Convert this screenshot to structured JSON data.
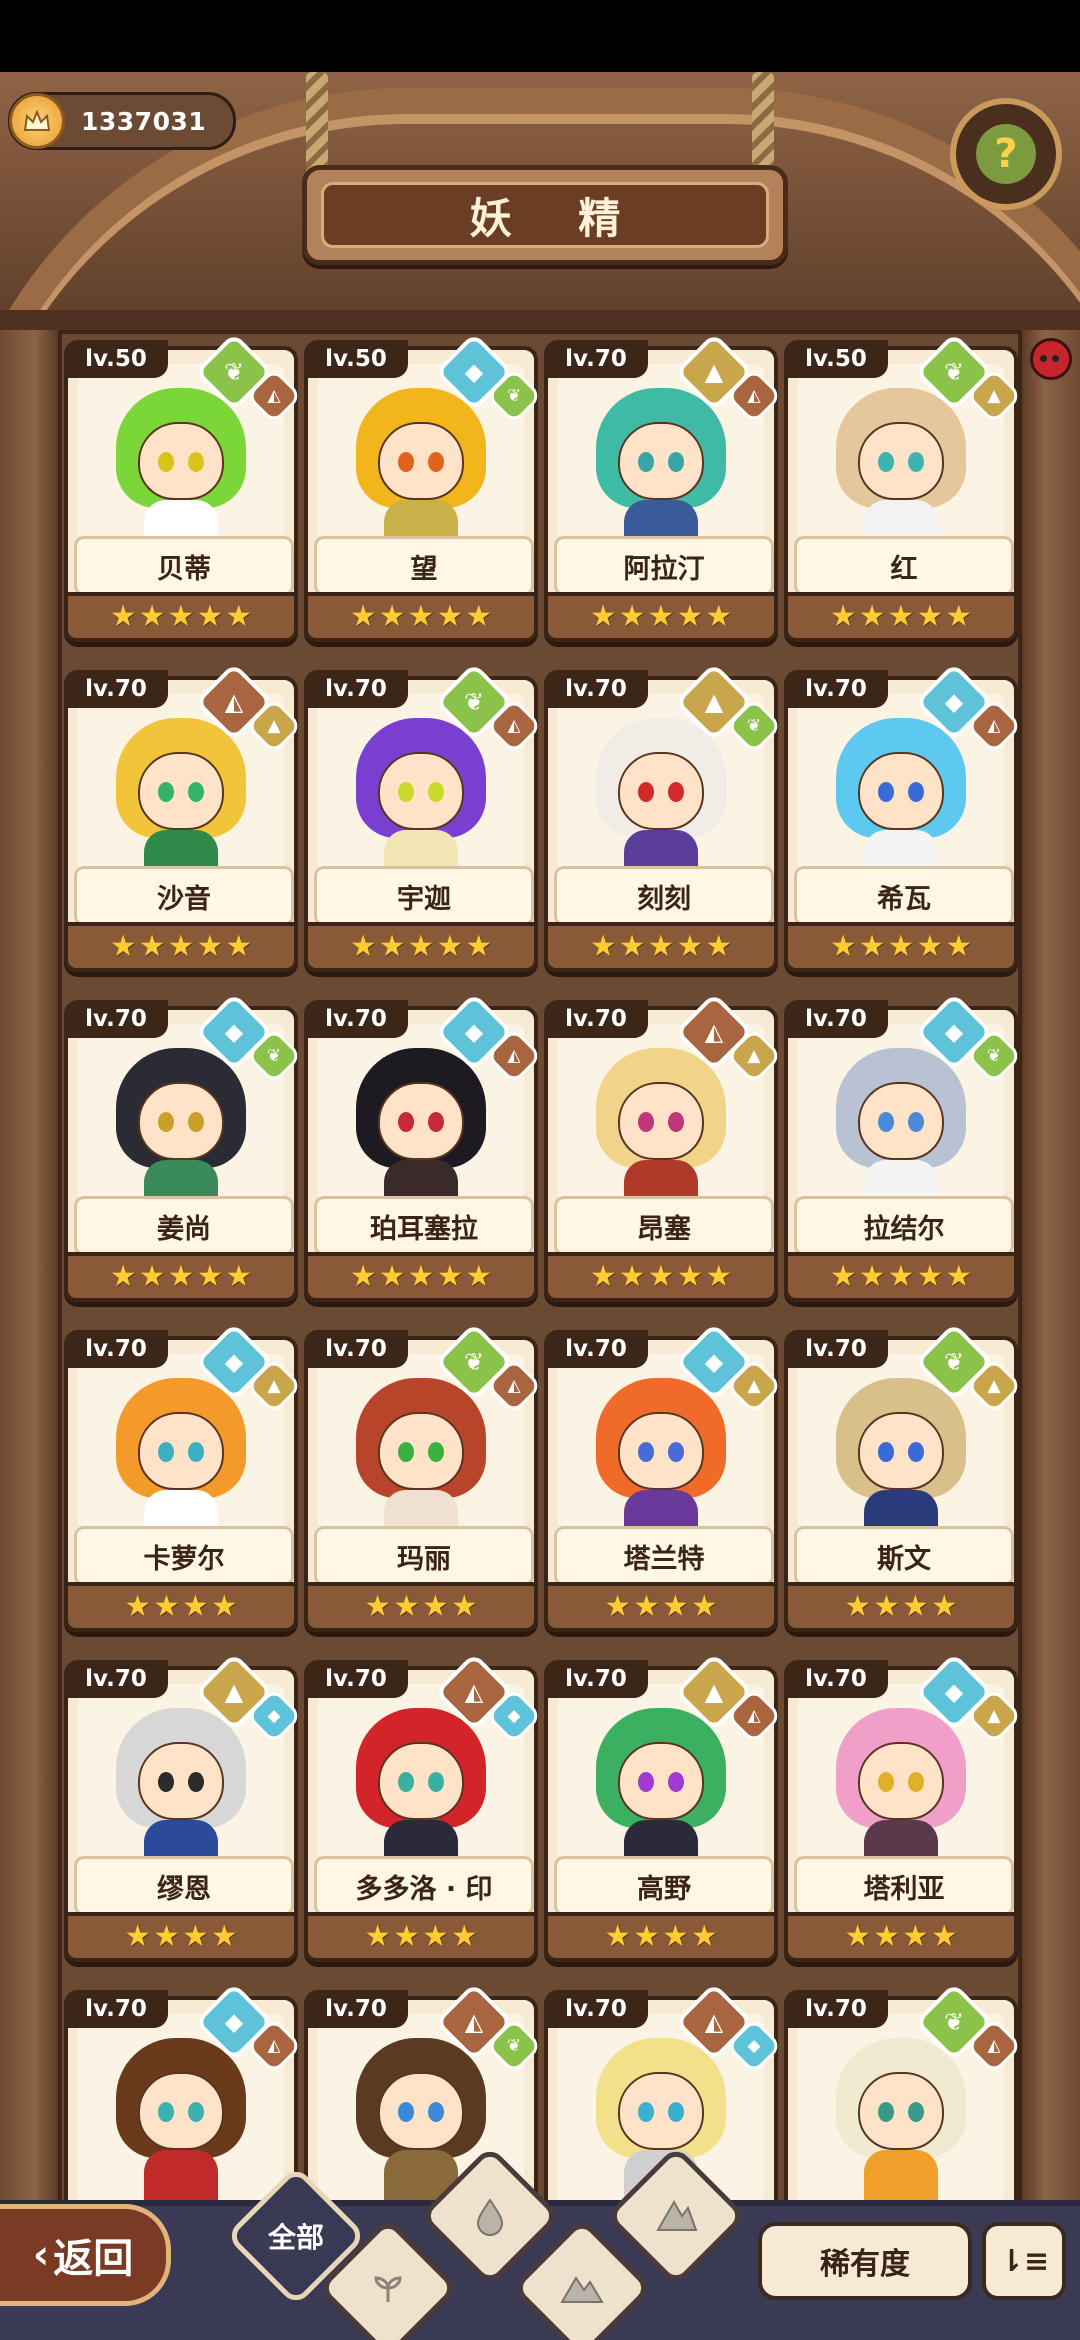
{
  "header": {
    "currency_value": "1337031",
    "title": "妖 精",
    "help_icon": "question-icon"
  },
  "fairies": [
    {
      "level": "lv.50",
      "name": "贝蒂",
      "stars": 5,
      "hair": "#7bd63a",
      "eye": "#d9c21a",
      "body": "#ffffff",
      "el1": "plant",
      "el2": "rock"
    },
    {
      "level": "lv.50",
      "name": "望",
      "stars": 5,
      "hair": "#f2b51c",
      "eye": "#e0641a",
      "body": "#c9b048",
      "el1": "water",
      "el2": "plant"
    },
    {
      "level": "lv.70",
      "name": "阿拉汀",
      "stars": 5,
      "hair": "#3fbba5",
      "eye": "#36a5a5",
      "body": "#3a5a9a",
      "el1": "earth",
      "el2": "rock"
    },
    {
      "level": "lv.50",
      "name": "红",
      "stars": 5,
      "hair": "#e4c79a",
      "eye": "#3fb3b0",
      "body": "#f2f2f2",
      "el1": "plant",
      "el2": "earth"
    },
    {
      "level": "lv.70",
      "name": "沙音",
      "stars": 5,
      "hair": "#f2c43a",
      "eye": "#35b36a",
      "body": "#2f8a4a",
      "el1": "rock",
      "el2": "earth"
    },
    {
      "level": "lv.70",
      "name": "宇迦",
      "stars": 5,
      "hair": "#7a3fd0",
      "eye": "#c7d92a",
      "body": "#f3e6b5",
      "el1": "plant",
      "el2": "rock"
    },
    {
      "level": "lv.70",
      "name": "刻刻",
      "stars": 5,
      "hair": "#f1ece6",
      "eye": "#d22a2a",
      "body": "#5a3d9a",
      "el1": "earth",
      "el2": "plant"
    },
    {
      "level": "lv.70",
      "name": "希瓦",
      "stars": 5,
      "hair": "#5ec9f0",
      "eye": "#3a6ad8",
      "body": "#f4f4f4",
      "el1": "water",
      "el2": "rock"
    },
    {
      "level": "lv.70",
      "name": "姜尚",
      "stars": 5,
      "hair": "#2b2b33",
      "eye": "#c9a12a",
      "body": "#3a8a5a",
      "el1": "water",
      "el2": "plant"
    },
    {
      "level": "lv.70",
      "name": "珀耳塞拉",
      "stars": 5,
      "hair": "#1e1a22",
      "eye": "#c42a3a",
      "body": "#3a2a2a",
      "el1": "water",
      "el2": "rock"
    },
    {
      "level": "lv.70",
      "name": "昂塞",
      "stars": 5,
      "hair": "#f1d38a",
      "eye": "#c0367a",
      "body": "#b03a2a",
      "el1": "rock",
      "el2": "earth"
    },
    {
      "level": "lv.70",
      "name": "拉结尔",
      "stars": 5,
      "hair": "#b8c2d2",
      "eye": "#4a8ad8",
      "body": "#f4f4f4",
      "el1": "water",
      "el2": "plant"
    },
    {
      "level": "lv.70",
      "name": "卡萝尔",
      "stars": 4,
      "hair": "#f39a2a",
      "eye": "#3ab0c0",
      "body": "#ffffff",
      "el1": "water",
      "el2": "earth"
    },
    {
      "level": "lv.70",
      "name": "玛丽",
      "stars": 4,
      "hair": "#b8442a",
      "eye": "#3ab040",
      "body": "#f0e0d0",
      "el1": "plant",
      "el2": "rock"
    },
    {
      "level": "lv.70",
      "name": "塔兰特",
      "stars": 4,
      "hair": "#f06a2a",
      "eye": "#4a6ad8",
      "body": "#6a3a9a",
      "el1": "water",
      "el2": "earth"
    },
    {
      "level": "lv.70",
      "name": "斯文",
      "stars": 4,
      "hair": "#d9c08a",
      "eye": "#3a6ad8",
      "body": "#2a3a7a",
      "el1": "plant",
      "el2": "earth"
    },
    {
      "level": "lv.70",
      "name": "缪恩",
      "stars": 4,
      "hair": "#d7d7d7",
      "eye": "#2b2b2b",
      "body": "#2a4a9a",
      "el1": "earth",
      "el2": "water"
    },
    {
      "level": "lv.70",
      "name": "多多洛 · 印",
      "stars": 4,
      "hair": "#d3242a",
      "eye": "#3ab0a0",
      "body": "#2a2a3a",
      "el1": "rock",
      "el2": "water"
    },
    {
      "level": "lv.70",
      "name": "高野",
      "stars": 4,
      "hair": "#3ab060",
      "eye": "#a03ad0",
      "body": "#2a2a3a",
      "el1": "earth",
      "el2": "rock"
    },
    {
      "level": "lv.70",
      "name": "塔利亚",
      "stars": 4,
      "hair": "#f0a0c8",
      "eye": "#e0b02a",
      "body": "#5a3a4a",
      "el1": "water",
      "el2": "earth"
    },
    {
      "level": "lv.70",
      "name": "",
      "stars": 0,
      "hair": "#6a3a1a",
      "eye": "#3ab0b0",
      "body": "#c02a2a",
      "el1": "water",
      "el2": "rock"
    },
    {
      "level": "lv.70",
      "name": "",
      "stars": 0,
      "hair": "#5a3a20",
      "eye": "#3a8ad8",
      "body": "#8a6a3a",
      "el1": "rock",
      "el2": "plant"
    },
    {
      "level": "lv.70",
      "name": "",
      "stars": 0,
      "hair": "#f2e08a",
      "eye": "#3ab0d0",
      "body": "#d0d0d0",
      "el1": "rock",
      "el2": "water"
    },
    {
      "level": "lv.70",
      "name": "",
      "stars": 0,
      "hair": "#f0ead0",
      "eye": "#3a9a8a",
      "body": "#f0a02a",
      "el1": "plant",
      "el2": "rock"
    }
  ],
  "bottom": {
    "back_label": "返回",
    "all_label": "全部",
    "rarity_label": "稀有度",
    "sort_icon": "sort-icon"
  },
  "colors": {
    "plant": "#8bc34a",
    "water": "#5ec3d8",
    "earth": "#c9a54c",
    "rock": "#a8653f",
    "star": "#ffcc33"
  }
}
